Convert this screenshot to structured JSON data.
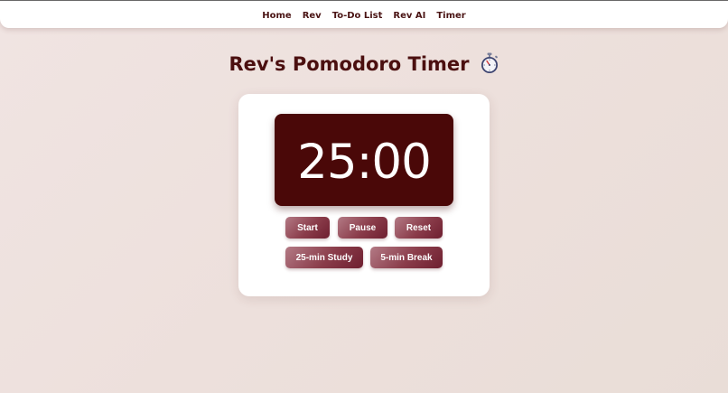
{
  "nav": {
    "links": [
      "Home",
      "Rev",
      "To-Do List",
      "Rev AI",
      "Timer"
    ]
  },
  "page": {
    "title": "Rev's Pomodoro Timer",
    "title_icon": "stopwatch-icon"
  },
  "timer": {
    "display": "25:00"
  },
  "controls": {
    "start_label": "Start",
    "pause_label": "Pause",
    "reset_label": "Reset",
    "study_label": "25-min Study",
    "break_label": "5-min Break"
  },
  "colors": {
    "accent": "#4a0808",
    "title": "#4b0f0f",
    "button_light": "#b37a85",
    "button_dark": "#6e1f30"
  }
}
